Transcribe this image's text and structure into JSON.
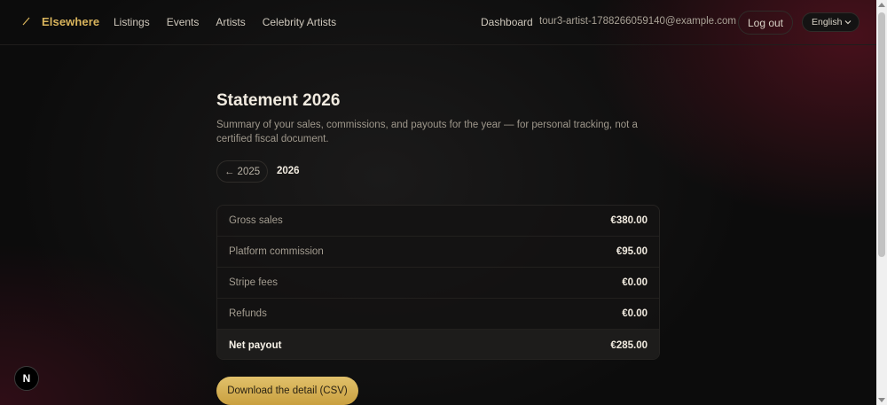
{
  "header": {
    "brand": "Elsewhere",
    "nav": [
      "Listings",
      "Events",
      "Artists",
      "Celebrity Artists"
    ],
    "dashboard": "Dashboard",
    "email": "tour3-artist-1788266059140@example.com",
    "logout": "Log out",
    "language": "English"
  },
  "page": {
    "title": "Statement 2026",
    "subtitle": "Summary of your sales, commissions, and payouts for the year — for personal tracking, not a certified fiscal document.",
    "prev_year": "← 2025",
    "current_year": "2026"
  },
  "statement": {
    "rows": [
      {
        "label": "Gross sales",
        "value": "€380.00"
      },
      {
        "label": "Platform commission",
        "value": "€95.00"
      },
      {
        "label": "Stripe fees",
        "value": "€0.00"
      },
      {
        "label": "Refunds",
        "value": "€0.00"
      },
      {
        "label": "Net payout",
        "value": "€285.00"
      }
    ]
  },
  "actions": {
    "download_csv": "Download the detail (CSV)"
  },
  "dev_badge": "N",
  "colors": {
    "accent": "#d9b45c",
    "button_gold": "#d4ae55",
    "background": "#0c0c0c"
  }
}
